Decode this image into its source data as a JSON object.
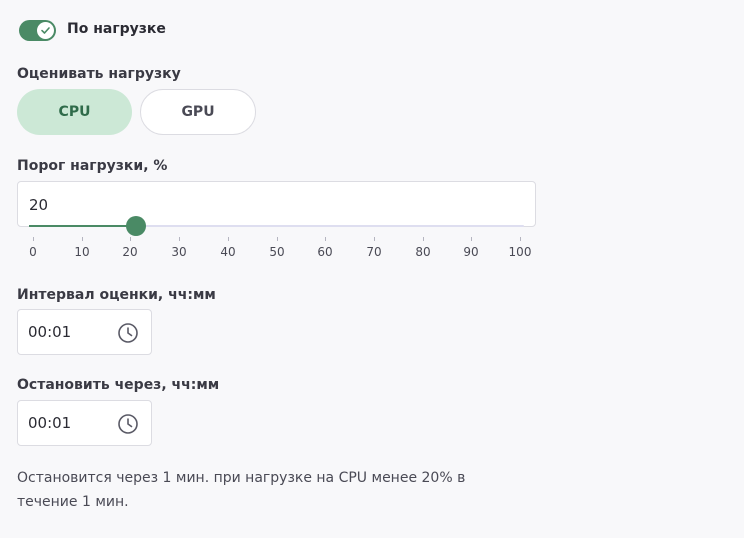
{
  "load_toggle": {
    "label": "По нагрузке",
    "enabled": true
  },
  "evaluate": {
    "label": "Оценивать нагрузку",
    "options": [
      "CPU",
      "GPU"
    ],
    "selected": "CPU"
  },
  "threshold": {
    "label": "Порог нагрузки, %",
    "value": "20",
    "slider_value": 20,
    "min": 0,
    "max": 100,
    "ticks": [
      "0",
      "10",
      "20",
      "30",
      "40",
      "50",
      "60",
      "70",
      "80",
      "90",
      "100"
    ]
  },
  "interval": {
    "label": "Интервал оценки, чч:мм",
    "value": "00:01"
  },
  "stop_after": {
    "label": "Остановить через, чч:мм",
    "value": "00:01"
  },
  "summary": "Остановится через 1 мин. при нагрузке на CPU менее 20% в течение 1 мин.",
  "colors": {
    "accent": "#4a8a65",
    "selected_bg": "#cce8d6",
    "selected_text": "#2f6b4a",
    "background": "#f8f8fa"
  },
  "icons": {
    "toggle": "check-icon",
    "time": "clock-icon"
  }
}
